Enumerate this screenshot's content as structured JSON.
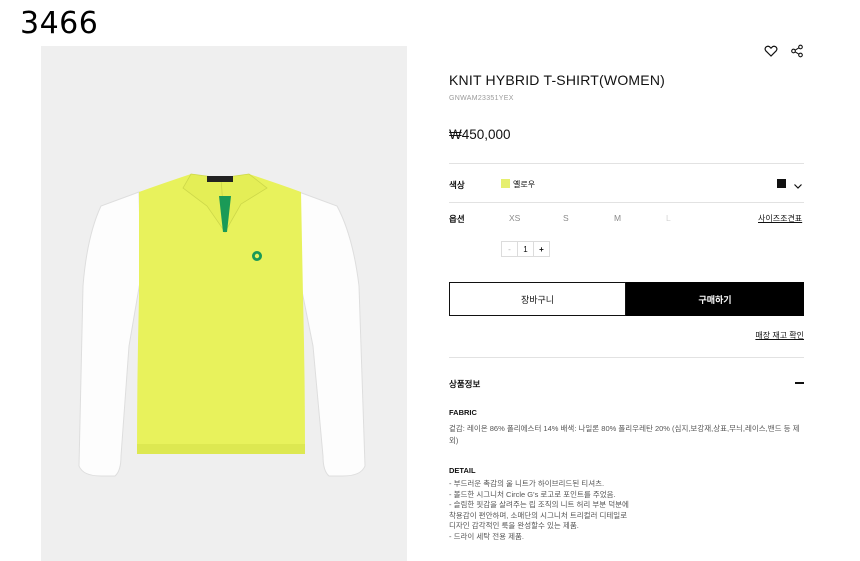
{
  "corner_label": "3466",
  "product": {
    "title": "KNIT HYBRID T-SHIRT(WOMEN)",
    "code": "GNWAM23351YEX",
    "price": "₩450,000"
  },
  "options": {
    "color_label": "색상",
    "color_name": "옐로우",
    "color_swatch": "#e6ef6e",
    "alt_color_swatch": "#111111",
    "size_label": "옵션",
    "sizes": [
      "XS",
      "S",
      "M",
      "L"
    ],
    "size_guide": "사이즈조견표",
    "quantity": "1",
    "minus": "-",
    "plus": "+"
  },
  "actions": {
    "cart": "장바구니",
    "buy": "구매하기",
    "store_stock": "매장 재고 확인"
  },
  "info": {
    "title": "상품정보",
    "fabric_head": "FABRIC",
    "fabric_text": "겉감: 레이온 86% 폴리에스터 14% 배색: 나일론 80% 폴리우레탄 20% (심지,보강재,상표,무늬,레이스,밴드 등 제외)",
    "detail_head": "DETAIL",
    "details": [
      "- 부드러운 촉감의 울 니트가 하이브리드된 티셔츠.",
      "- 볼드한 시그니처 Circle G's 로고로 포인트를 주었음.",
      "- 슬림한 핏감을 살려주는 립 조직의 니트 허리 부분 덕분에",
      "  착용감이 편안하며, 소매단의 시그니처 트리컬러 디테일로",
      "  디자인 감각적인 룩을 완성할수 있는 제품.",
      "- 드라이 세탁 전용 제품."
    ]
  },
  "colors": {
    "garment_body": "#e8f25c",
    "garment_sleeve": "#ffffff",
    "placket_accent": "#1a9a57",
    "image_bg": "#efefef"
  }
}
